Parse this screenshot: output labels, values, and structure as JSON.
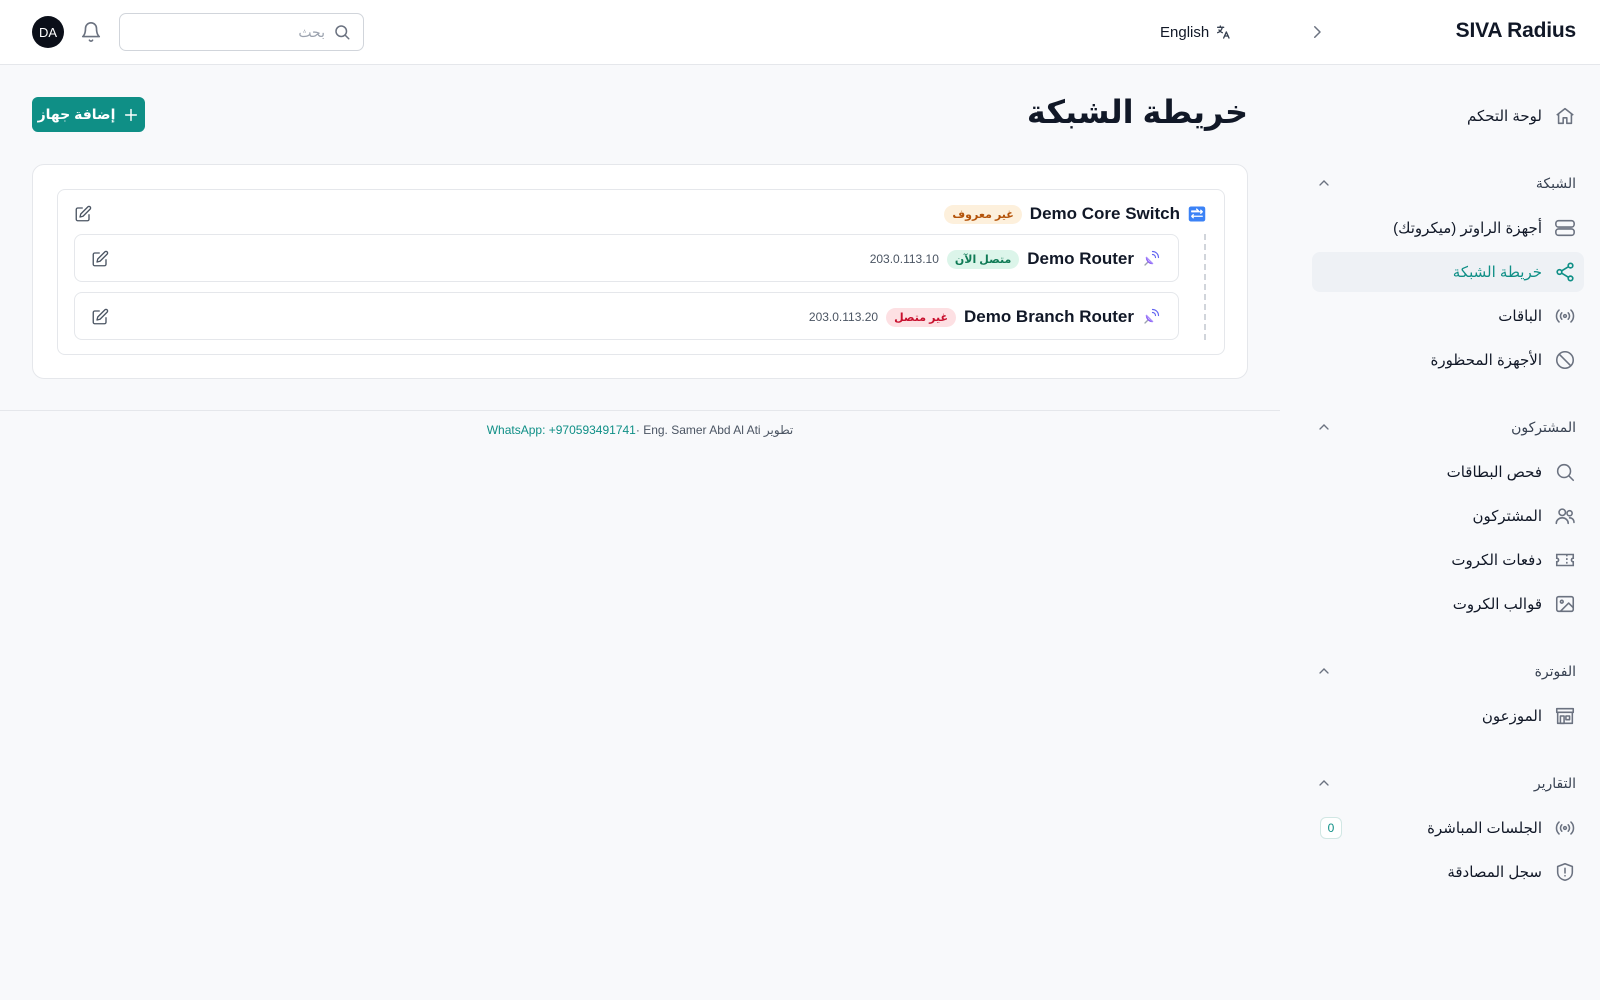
{
  "app": {
    "brand": "SIVA Radius"
  },
  "header": {
    "language_label": "English",
    "search_placeholder": "بحث",
    "avatar_initials": "DA"
  },
  "sidebar": {
    "dashboard": "لوحة التحكم",
    "sections": {
      "network": "الشبكة",
      "subscribers": "المشتركون",
      "billing": "الفوترة",
      "reports": "التقارير"
    },
    "items": {
      "routers": "أجهزة الراوتر (ميكروتك)",
      "network_map": "خريطة الشبكة",
      "packages": "الباقات",
      "blocked": "الأجهزة المحظورة",
      "card_check": "فحص البطاقات",
      "subscribers": "المشتركون",
      "card_batches": "دفعات الكروت",
      "card_templates": "قوالب الكروت",
      "distributors": "الموزعون",
      "live_sessions": "الجلسات المباشرة",
      "auth_log": "سجل المصادقة"
    },
    "live_sessions_count": "0"
  },
  "main": {
    "title": "خريطة الشبكة",
    "add_device_label": "إضافة جهاز",
    "switch": {
      "name": "Demo Core Switch",
      "status": "غير معروف"
    },
    "routers": [
      {
        "name": "Demo Router",
        "status": "متصل الآن",
        "ip": "203.0.113.10"
      },
      {
        "name": "Demo Branch Router",
        "status": "غير متصل",
        "ip": "203.0.113.20"
      }
    ]
  },
  "footer": {
    "credit": "تطوير Eng. Samer Abd Al Ati · ",
    "whatsapp": "WhatsApp: +970593491741"
  },
  "colors": {
    "accent": "#0f8f86",
    "online": "#0f7a55",
    "offline": "#c8102e",
    "unknown": "#b45309"
  }
}
